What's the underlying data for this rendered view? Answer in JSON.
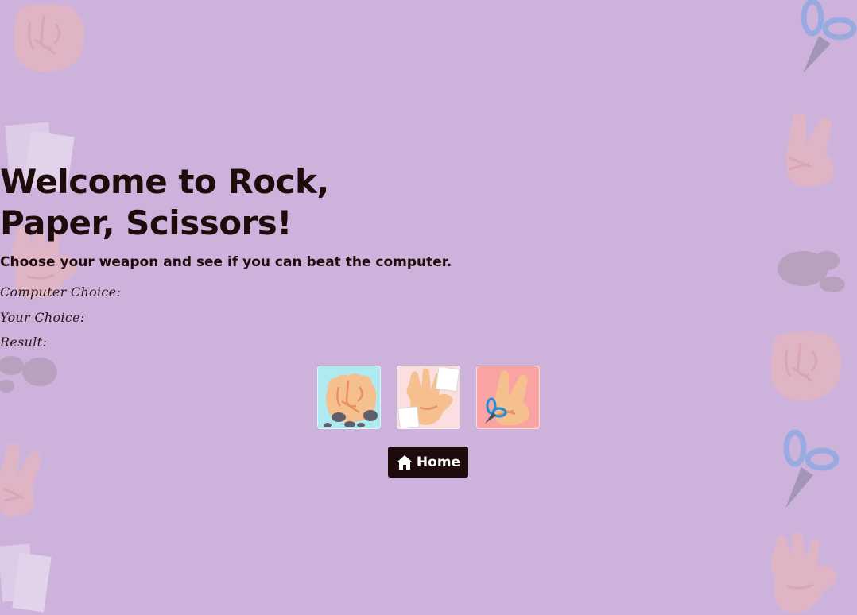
{
  "header": {
    "title_line1": "Welcome to Rock,",
    "title_line2": "Paper, Scissors!",
    "subtitle": "Choose your weapon and see if you can beat the computer."
  },
  "status": {
    "computer_choice_label": "Computer Choice:",
    "your_choice_label": "Your Choice:",
    "result_label": "Result:"
  },
  "choices": [
    {
      "name": "rock",
      "icon": "rock-fist-icon",
      "bg": "#aeeaf0"
    },
    {
      "name": "paper",
      "icon": "paper-hand-icon",
      "bg": "#fbdfe0"
    },
    {
      "name": "scissors",
      "icon": "scissors-hand-icon",
      "bg": "#f9a3a3"
    }
  ],
  "home_button": {
    "label": "Home",
    "icon": "home-icon"
  },
  "colors": {
    "background": "#cdb3dc",
    "text": "#1e0c0c",
    "button": "#1e0c0c",
    "skin": "#f6c08e",
    "line": "#e89060"
  }
}
